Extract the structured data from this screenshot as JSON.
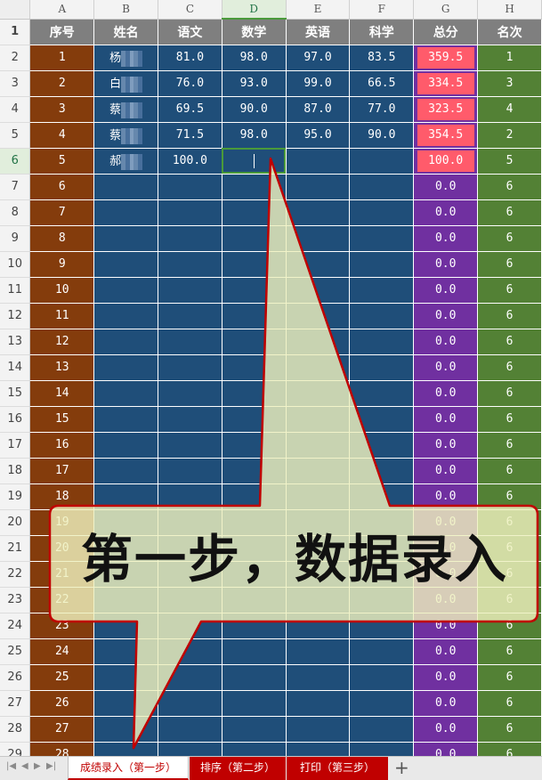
{
  "columns": [
    "A",
    "B",
    "C",
    "D",
    "E",
    "F",
    "G",
    "H"
  ],
  "selected_column": "D",
  "selected_row": "6",
  "headers": [
    "序号",
    "姓名",
    "语文",
    "数学",
    "英语",
    "科学",
    "总分",
    "名次"
  ],
  "rows": [
    {
      "row": "2",
      "cells": [
        "1",
        "杨",
        "81.0",
        "98.0",
        "97.0",
        "83.5",
        "359.5",
        "1"
      ]
    },
    {
      "row": "3",
      "cells": [
        "2",
        "白",
        "76.0",
        "93.0",
        "99.0",
        "66.5",
        "334.5",
        "3"
      ]
    },
    {
      "row": "4",
      "cells": [
        "3",
        "蔡",
        "69.5",
        "90.0",
        "87.0",
        "77.0",
        "323.5",
        "4"
      ]
    },
    {
      "row": "5",
      "cells": [
        "4",
        "蔡",
        "71.5",
        "98.0",
        "95.0",
        "90.0",
        "354.5",
        "2"
      ]
    },
    {
      "row": "6",
      "cells": [
        "5",
        "郝",
        "100.0",
        "",
        "",
        "",
        "100.0",
        "5"
      ]
    },
    {
      "row": "7",
      "cells": [
        "6",
        "",
        "",
        "",
        "",
        "",
        "0.0",
        "6"
      ]
    },
    {
      "row": "8",
      "cells": [
        "7",
        "",
        "",
        "",
        "",
        "",
        "0.0",
        "6"
      ]
    },
    {
      "row": "9",
      "cells": [
        "8",
        "",
        "",
        "",
        "",
        "",
        "0.0",
        "6"
      ]
    },
    {
      "row": "10",
      "cells": [
        "9",
        "",
        "",
        "",
        "",
        "",
        "0.0",
        "6"
      ]
    },
    {
      "row": "11",
      "cells": [
        "10",
        "",
        "",
        "",
        "",
        "",
        "0.0",
        "6"
      ]
    },
    {
      "row": "12",
      "cells": [
        "11",
        "",
        "",
        "",
        "",
        "",
        "0.0",
        "6"
      ]
    },
    {
      "row": "13",
      "cells": [
        "12",
        "",
        "",
        "",
        "",
        "",
        "0.0",
        "6"
      ]
    },
    {
      "row": "14",
      "cells": [
        "13",
        "",
        "",
        "",
        "",
        "",
        "0.0",
        "6"
      ]
    },
    {
      "row": "15",
      "cells": [
        "14",
        "",
        "",
        "",
        "",
        "",
        "0.0",
        "6"
      ]
    },
    {
      "row": "16",
      "cells": [
        "15",
        "",
        "",
        "",
        "",
        "",
        "0.0",
        "6"
      ]
    },
    {
      "row": "17",
      "cells": [
        "16",
        "",
        "",
        "",
        "",
        "",
        "0.0",
        "6"
      ]
    },
    {
      "row": "18",
      "cells": [
        "17",
        "",
        "",
        "",
        "",
        "",
        "0.0",
        "6"
      ]
    },
    {
      "row": "19",
      "cells": [
        "18",
        "",
        "",
        "",
        "",
        "",
        "0.0",
        "6"
      ]
    },
    {
      "row": "20",
      "cells": [
        "19",
        "",
        "",
        "",
        "",
        "",
        "0.0",
        "6"
      ]
    },
    {
      "row": "21",
      "cells": [
        "20",
        "",
        "",
        "",
        "",
        "",
        "0.0",
        "6"
      ]
    },
    {
      "row": "22",
      "cells": [
        "21",
        "",
        "",
        "",
        "",
        "",
        "0.0",
        "6"
      ]
    },
    {
      "row": "23",
      "cells": [
        "22",
        "",
        "",
        "",
        "",
        "",
        "0.0",
        "6"
      ]
    },
    {
      "row": "24",
      "cells": [
        "23",
        "",
        "",
        "",
        "",
        "",
        "0.0",
        "6"
      ]
    },
    {
      "row": "25",
      "cells": [
        "24",
        "",
        "",
        "",
        "",
        "",
        "0.0",
        "6"
      ]
    },
    {
      "row": "26",
      "cells": [
        "25",
        "",
        "",
        "",
        "",
        "",
        "0.0",
        "6"
      ]
    },
    {
      "row": "27",
      "cells": [
        "26",
        "",
        "",
        "",
        "",
        "",
        "0.0",
        "6"
      ]
    },
    {
      "row": "28",
      "cells": [
        "27",
        "",
        "",
        "",
        "",
        "",
        "0.0",
        "6"
      ]
    },
    {
      "row": "29",
      "cells": [
        "28",
        "",
        "",
        "",
        "",
        "",
        "0.0",
        "6"
      ]
    }
  ],
  "callout": {
    "text": "第一步，数据录入",
    "fill": "#eef0bd",
    "border": "#c00000"
  },
  "sheet_tabs": [
    {
      "label": "成绩录入（第一步）",
      "active": true
    },
    {
      "label": "排序（第二步）",
      "active": false
    },
    {
      "label": "打印（第三步）",
      "active": false
    }
  ],
  "add_sheet_label": "+",
  "colors": {
    "col_seq": "#843c0c",
    "col_data": "#1f4e79",
    "col_total": "#7030a0",
    "col_rank": "#538135",
    "header_bg": "#7f7f7f",
    "highlight_total": "#ff5b6b"
  }
}
